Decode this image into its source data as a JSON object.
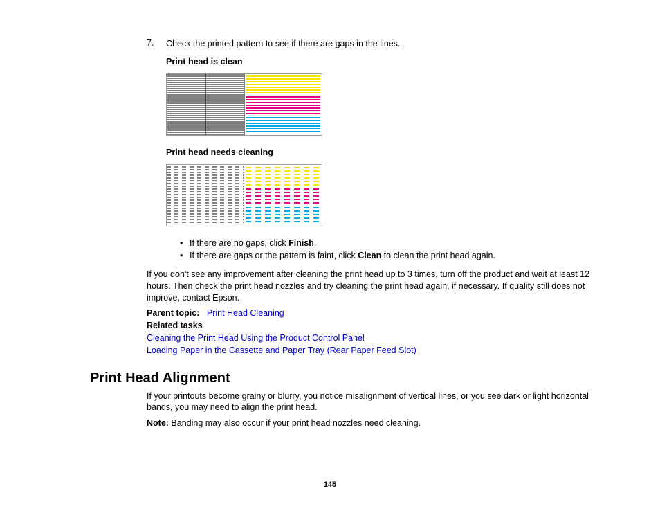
{
  "step": {
    "number": "7.",
    "text_a": "Check the printed pattern to see if there are gaps in the lines.",
    "label_clean": "Print head is clean",
    "label_dirty": "Print head needs cleaning",
    "bullets": [
      {
        "pre": "If there are no gaps, click ",
        "b": "Finish",
        "post": "."
      },
      {
        "pre": "If there are gaps or the pattern is faint, click ",
        "b": "Clean",
        "post": " to clean the print head again."
      }
    ]
  },
  "followup": "If you don't see any improvement after cleaning the print head up to 3 times, turn off the product and wait at least 12 hours. Then check the print head nozzles and try cleaning the print head again, if necessary. If quality still does not improve, contact Epson.",
  "parent_topic": {
    "label": "Parent topic:",
    "link": "Print Head Cleaning"
  },
  "related": {
    "label": "Related tasks",
    "links": [
      "Cleaning the Print Head Using the Product Control Panel",
      "Loading Paper in the Cassette and Paper Tray (Rear Paper Feed Slot)"
    ]
  },
  "section2": {
    "title": "Print Head Alignment",
    "p1": "If your printouts become grainy or blurry, you notice misalignment of vertical lines, or you see dark or light horizontal bands, you may need to align the print head.",
    "note_label": "Note:",
    "note_text": " Banding may also occur if your print head nozzles need cleaning."
  },
  "page_number": "145"
}
